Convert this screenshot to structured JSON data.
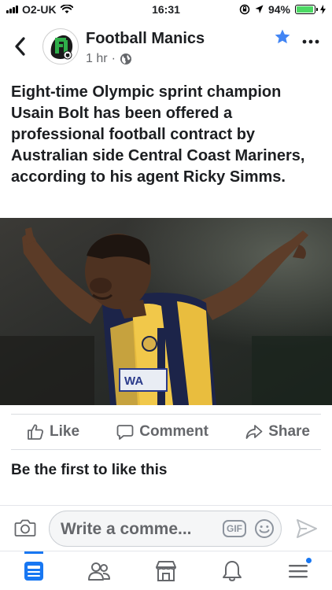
{
  "status_bar": {
    "carrier": "O2-UK",
    "time": "16:31",
    "battery_percent": "94%",
    "battery_level": 0.94
  },
  "post": {
    "page_name": "Football Manics",
    "time_ago": "1 hr",
    "separator": "·",
    "text": "Eight-time Olympic sprint champion Usain Bolt has been offered a professional football contract by Australian side Central Coast Mariners, according to his agent Ricky Simms.",
    "photo_shirt_text": "WA"
  },
  "actions": {
    "like_label": "Like",
    "comment_label": "Comment",
    "share_label": "Share"
  },
  "likes_text": "Be the first to like this",
  "comment_box": {
    "placeholder": "Write a comme...",
    "gif_label": "GIF"
  },
  "icons": {
    "back": "chevron-left-icon",
    "star": "star-icon",
    "more": "more-dots-icon",
    "globe": "globe-icon",
    "like": "thumbs-up-icon",
    "comment": "speech-bubble-icon",
    "share": "share-arrow-icon",
    "camera": "camera-icon",
    "emoji": "smiley-icon",
    "send": "send-icon",
    "tabs": [
      "news-feed-icon",
      "friends-icon",
      "marketplace-icon",
      "notifications-icon",
      "menu-icon"
    ]
  },
  "colors": {
    "accent": "#1877f2",
    "text": "#1c1e21",
    "secondary": "#65676b",
    "battery": "#4cd964"
  }
}
